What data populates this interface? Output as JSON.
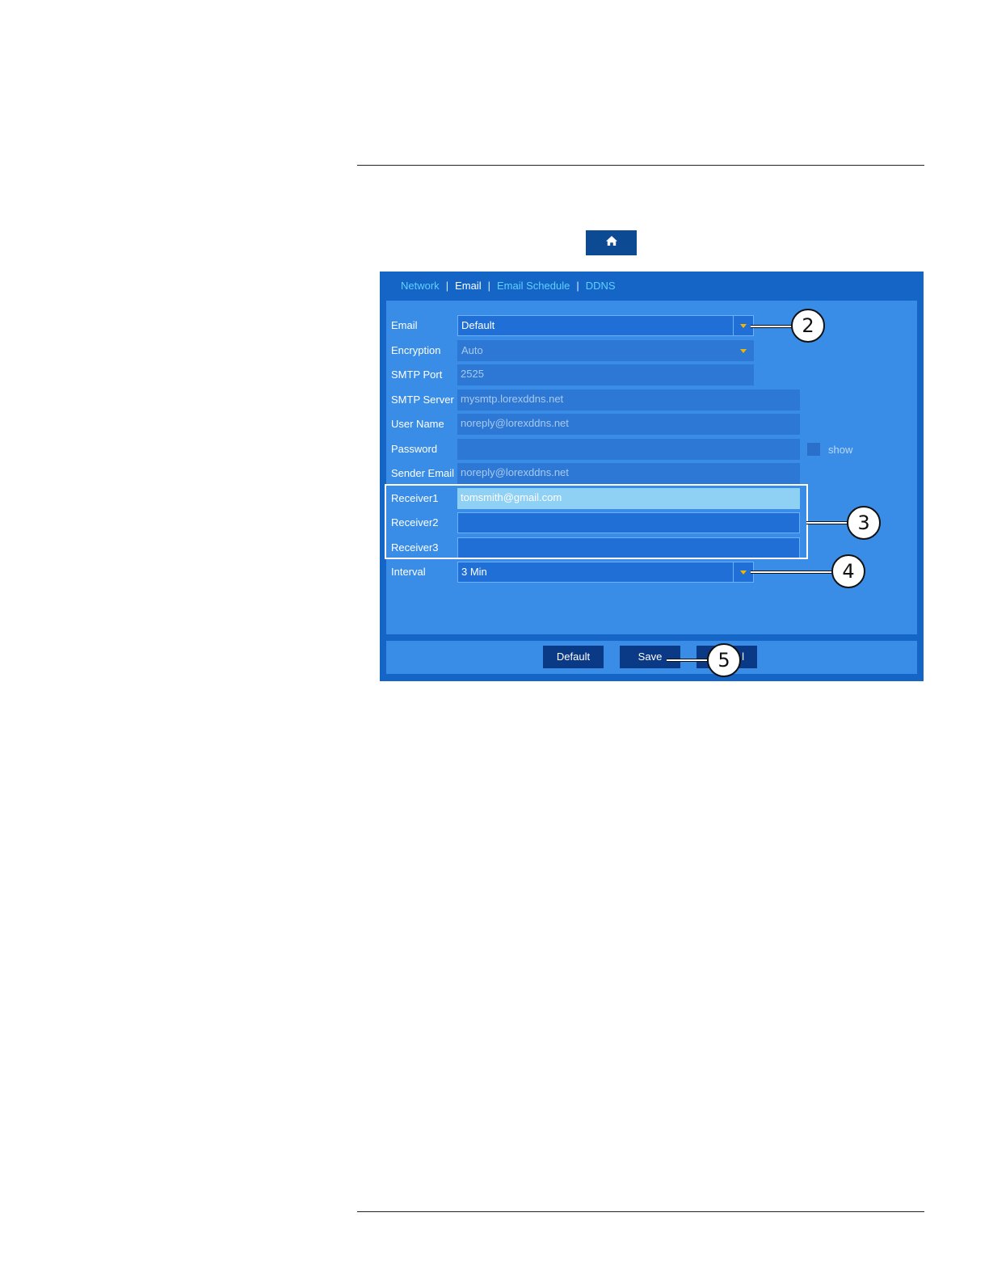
{
  "tabs": [
    {
      "label": "Network",
      "active": false
    },
    {
      "label": "Email",
      "active": true
    },
    {
      "label": "Email Schedule",
      "active": false
    },
    {
      "label": "DDNS",
      "active": false
    }
  ],
  "tab_separator": "|",
  "form": {
    "email": {
      "label": "Email",
      "value": "Default"
    },
    "encryption": {
      "label": "Encryption",
      "value": "Auto"
    },
    "smtp_port": {
      "label": "SMTP Port",
      "value": "2525"
    },
    "smtp_server": {
      "label": "SMTP Server",
      "value": "mysmtp.lorexddns.net"
    },
    "user_name": {
      "label": "User Name",
      "value": "noreply@lorexddns.net"
    },
    "password": {
      "label": "Password",
      "value": "",
      "show_label": "show"
    },
    "sender_email": {
      "label": "Sender Email",
      "value": "noreply@lorexddns.net"
    },
    "receiver1": {
      "label": "Receiver1",
      "value": "tomsmith@gmail.com"
    },
    "receiver2": {
      "label": "Receiver2",
      "value": ""
    },
    "receiver3": {
      "label": "Receiver3",
      "value": ""
    },
    "interval": {
      "label": "Interval",
      "value": "3 Min"
    }
  },
  "footer": {
    "default_label": "Default",
    "save_label": "Save",
    "cancel_label": "l"
  },
  "callouts": {
    "c2": "2",
    "c3": "3",
    "c4": "4",
    "c5": "5"
  },
  "icons": {
    "home": "home-icon",
    "dropdown": "chevron-down-icon"
  },
  "colors": {
    "panel": "#1565c7",
    "content": "#3a8de6",
    "tab_link": "#5fd0ff",
    "button": "#0a3a86",
    "dropdown_arrow": "#f5b400"
  }
}
